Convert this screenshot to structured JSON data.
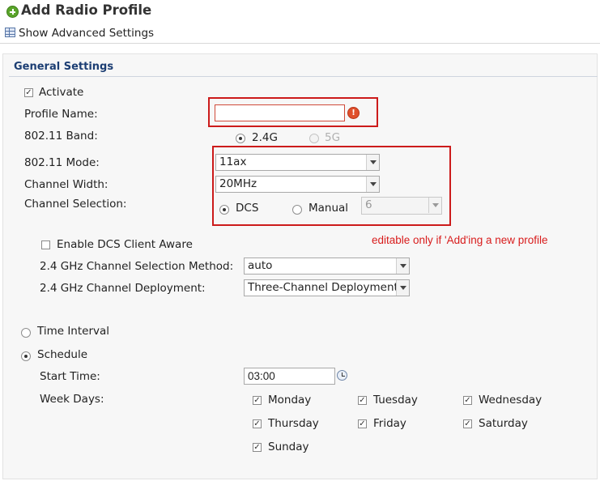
{
  "header": {
    "title": "Add Radio Profile",
    "advanced_link": "Show Advanced Settings"
  },
  "general": {
    "section_title": "General Settings",
    "activate_label": "Activate",
    "activate_checked": true,
    "profile_name_label": "Profile Name:",
    "profile_name_value": "",
    "band_label": "802.11 Band:",
    "band_24": "2.4G",
    "band_5": "5G",
    "band_selected": "2.4G",
    "mode_label": "802.11 Mode:",
    "mode_value": "11ax",
    "width_label": "Channel Width:",
    "width_value": "20MHz",
    "selection_label": "Channel Selection:",
    "dcs_label": "DCS",
    "manual_label": "Manual",
    "manual_channel": "6",
    "note": "editable only if 'Add'ing a new profile"
  },
  "dcs": {
    "client_aware_label": "Enable DCS Client Aware",
    "client_aware_checked": false,
    "method_label": "2.4 GHz Channel Selection Method:",
    "method_value": "auto",
    "deployment_label": "2.4 GHz Channel Deployment:",
    "deployment_value": "Three-Channel Deployment",
    "time_interval_label": "Time Interval",
    "schedule_label": "Schedule",
    "schedule_selected": "Schedule",
    "start_time_label": "Start Time:",
    "start_time_value": "03:00",
    "week_days_label": "Week Days:",
    "days": [
      {
        "label": "Monday",
        "checked": true
      },
      {
        "label": "Tuesday",
        "checked": true
      },
      {
        "label": "Wednesday",
        "checked": true
      },
      {
        "label": "Thursday",
        "checked": true
      },
      {
        "label": "Friday",
        "checked": true
      },
      {
        "label": "Saturday",
        "checked": true
      },
      {
        "label": "Sunday",
        "checked": true
      }
    ]
  },
  "colors": {
    "highlight_border": "#cc1b1b",
    "note_text": "#d81c1c",
    "section_title": "#1c3e73"
  },
  "icons": {
    "title": "add-circle-icon",
    "advanced": "table-icon",
    "profile_warning": "warning-icon",
    "start_time": "clock-icon"
  }
}
